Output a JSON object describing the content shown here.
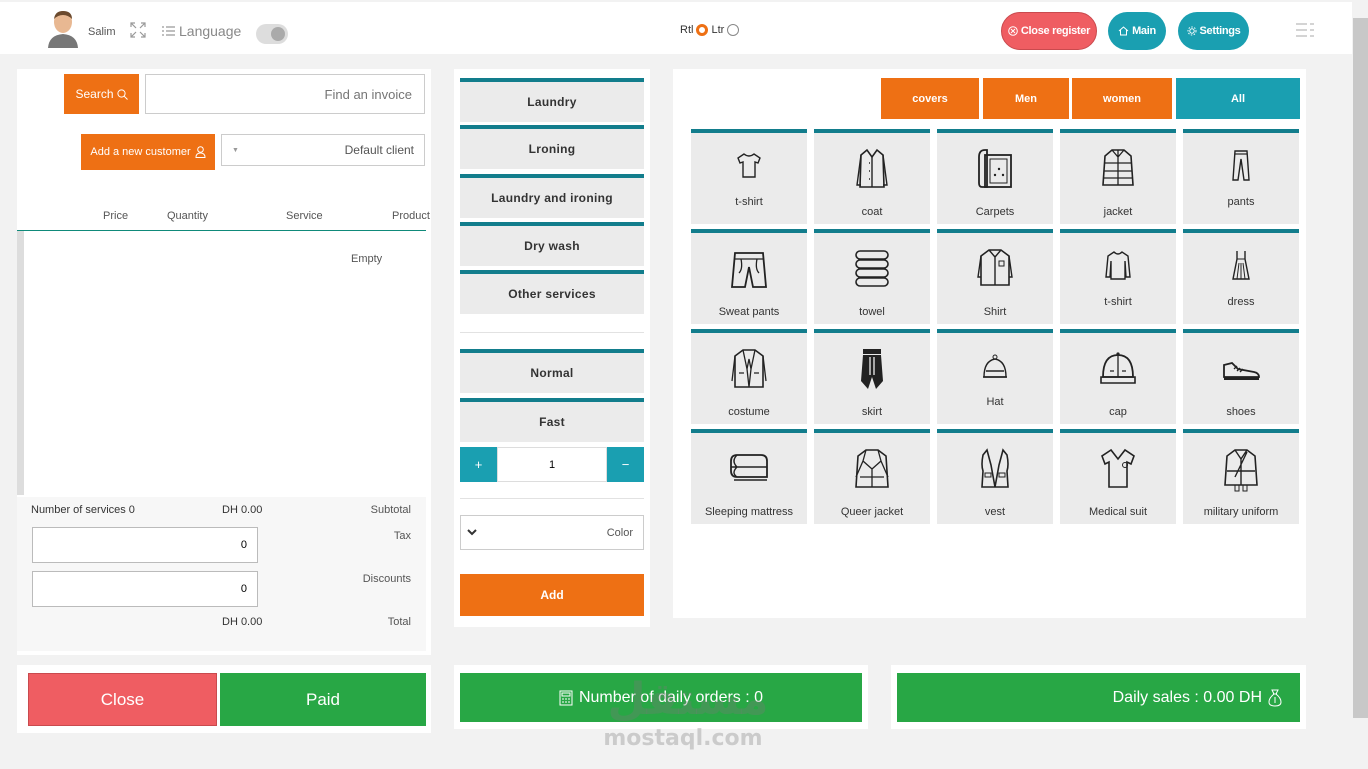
{
  "header": {
    "user_name": "Salim",
    "language_label": "Language",
    "rtl_label": "Rtl",
    "ltr_label": "Ltr",
    "close_register_label": "Close register",
    "main_label": "Main",
    "settings_label": "Settings"
  },
  "invoice": {
    "search_label": "Search",
    "find_placeholder": "Find an invoice",
    "add_customer_label": "Add a new customer",
    "client_selected": "Default client",
    "columns": [
      "Price",
      "Quantity",
      "Service",
      "Product"
    ],
    "empty_text": "Empty",
    "services_count_label": "Number of services 0",
    "subtotal_value": "DH 0.00",
    "subtotal_label": "Subtotal",
    "tax_value": "0",
    "tax_label": "Tax",
    "discount_value": "0",
    "discount_label": "Discounts",
    "total_value": "DH 0.00",
    "total_label": "Total",
    "close_label": "Close",
    "paid_label": "Paid"
  },
  "services": {
    "types": [
      "Laundry",
      "Lroning",
      "Laundry and ironing",
      "Dry wash",
      "Other services"
    ],
    "speeds": [
      "Normal",
      "Fast"
    ],
    "plus_label": "+",
    "minus_label": "−",
    "quantity": "1",
    "color_label": "Color",
    "add_label": "Add"
  },
  "catalog": {
    "categories": [
      "covers",
      "Men",
      "women",
      "All"
    ],
    "products": [
      {
        "label": "t-shirt",
        "icon": "tshirt-icon"
      },
      {
        "label": "coat",
        "icon": "coat-icon"
      },
      {
        "label": "Carpets",
        "icon": "carpet-icon"
      },
      {
        "label": "jacket",
        "icon": "jacket-icon"
      },
      {
        "label": "pants",
        "icon": "pants-icon"
      },
      {
        "label": "Sweat pants",
        "icon": "shorts-icon"
      },
      {
        "label": "towel",
        "icon": "towel-icon"
      },
      {
        "label": "Shirt",
        "icon": "shirt-icon"
      },
      {
        "label": "t-shirt",
        "icon": "longsleeve-icon"
      },
      {
        "label": "dress",
        "icon": "dress-icon"
      },
      {
        "label": "costume",
        "icon": "suit-icon"
      },
      {
        "label": "skirt",
        "icon": "skirt-icon"
      },
      {
        "label": "Hat",
        "icon": "hat-icon"
      },
      {
        "label": "cap",
        "icon": "cap-icon"
      },
      {
        "label": "shoes",
        "icon": "shoe-icon"
      },
      {
        "label": "Sleeping mattress",
        "icon": "mattress-icon"
      },
      {
        "label": "Queer jacket",
        "icon": "leather-jacket-icon"
      },
      {
        "label": "vest",
        "icon": "vest-icon"
      },
      {
        "label": "Medical suit",
        "icon": "scrubs-icon"
      },
      {
        "label": "military uniform",
        "icon": "uniform-icon"
      }
    ]
  },
  "stats": {
    "daily_orders": "Number of daily orders : 0",
    "daily_sales": "Daily sales : 0.00 DH"
  },
  "watermark": {
    "arabic": "مستقل",
    "latin": "mostaql.com"
  },
  "colors": {
    "orange": "#ee7014",
    "teal": "#1a9fb1",
    "green": "#28a745",
    "red": "#ef5d62"
  }
}
